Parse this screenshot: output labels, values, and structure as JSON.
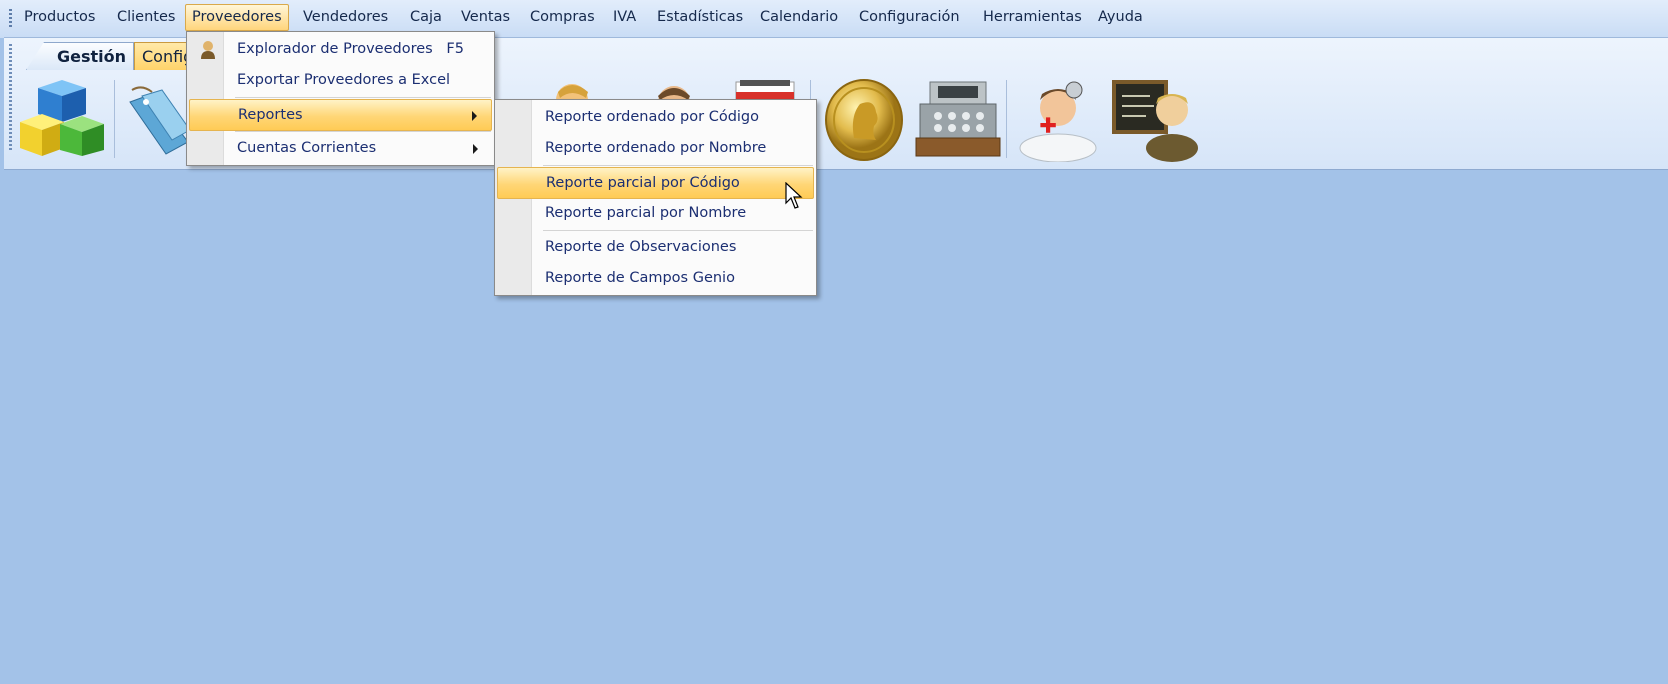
{
  "menubar": {
    "items": [
      "Productos",
      "Clientes",
      "Proveedores",
      "Vendedores",
      "Caja",
      "Ventas",
      "Compras",
      "IVA",
      "Estadísticas",
      "Calendario",
      "Configuración",
      "Herramientas",
      "Ayuda"
    ],
    "open_item": "Proveedores"
  },
  "ribbon": {
    "tabs": [
      "Gestión",
      "Configuración"
    ],
    "tab_config_visible_text": "Config",
    "icons": [
      "cubes-icon",
      "price-tags-icon",
      "supplier-person-icon",
      "seller-person-icon",
      "calendar-icon",
      "gold-coin-icon",
      "cash-register-icon",
      "doctor-icon",
      "teacher-icon"
    ]
  },
  "proveedores_menu": {
    "items": [
      {
        "label": "Explorador de Proveedores",
        "shortcut": "F5",
        "icon": "supplier-icon"
      },
      {
        "label": "Exportar Proveedores a Excel"
      },
      {
        "label": "Reportes",
        "submenu": true,
        "highlighted": true
      },
      {
        "label": "Cuentas Corrientes",
        "submenu": true
      }
    ]
  },
  "reportes_submenu": {
    "items": [
      {
        "label": "Reporte ordenado por Código"
      },
      {
        "label": "Reporte ordenado por Nombre"
      },
      {
        "label": "Reporte parcial por Código",
        "highlighted": true
      },
      {
        "label": "Reporte parcial por Nombre"
      },
      {
        "label": "Reporte de Observaciones"
      },
      {
        "label": "Reporte de Campos Genio"
      }
    ]
  },
  "colors": {
    "desktop": "#a3c2e8",
    "menubar": "#d5e4f7",
    "highlight": "#ffd676",
    "menu_text": "#1c2f72"
  }
}
